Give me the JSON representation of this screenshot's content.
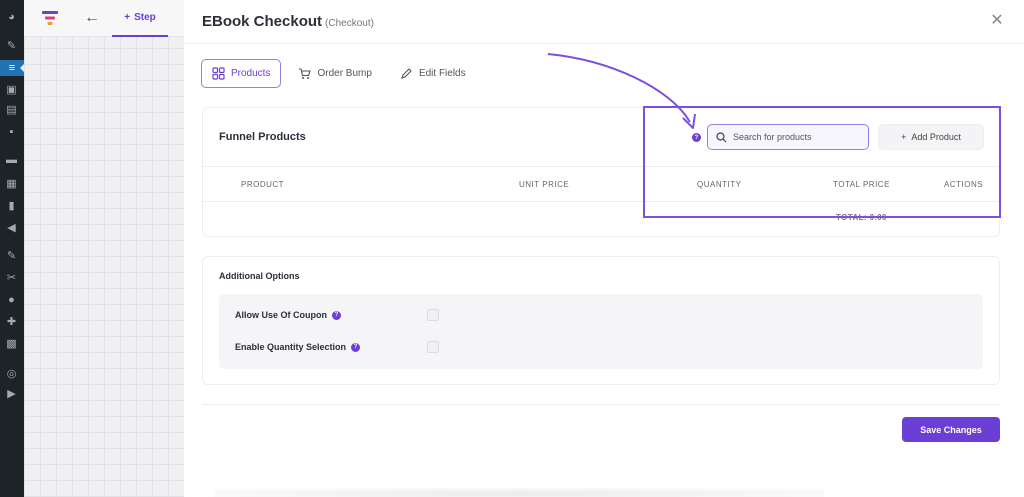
{
  "builder": {
    "step_label": "Step"
  },
  "modal": {
    "title": "EBook Checkout",
    "subtitle": "(Checkout)"
  },
  "tabs": [
    {
      "label": "Products",
      "active": true
    },
    {
      "label": "Order Bump",
      "active": false
    },
    {
      "label": "Edit Fields",
      "active": false
    }
  ],
  "products": {
    "title": "Funnel Products",
    "search": {
      "placeholder": "Search for products",
      "value": ""
    },
    "add_label": "Add Product",
    "columns": [
      "PRODUCT",
      "UNIT PRICE",
      "QUANTITY",
      "TOTAL PRICE",
      "ACTIONS"
    ],
    "total": "TOTAL: 0.00"
  },
  "options": {
    "title": "Additional Options",
    "items": [
      {
        "label": "Allow Use Of Coupon",
        "checked": false
      },
      {
        "label": "Enable Quantity Selection",
        "checked": false
      }
    ]
  },
  "save_label": "Save Changes",
  "colors": {
    "accent": "#6b3fd6",
    "annotation": "#7b4fe0",
    "wp_admin": "#1d2327"
  }
}
